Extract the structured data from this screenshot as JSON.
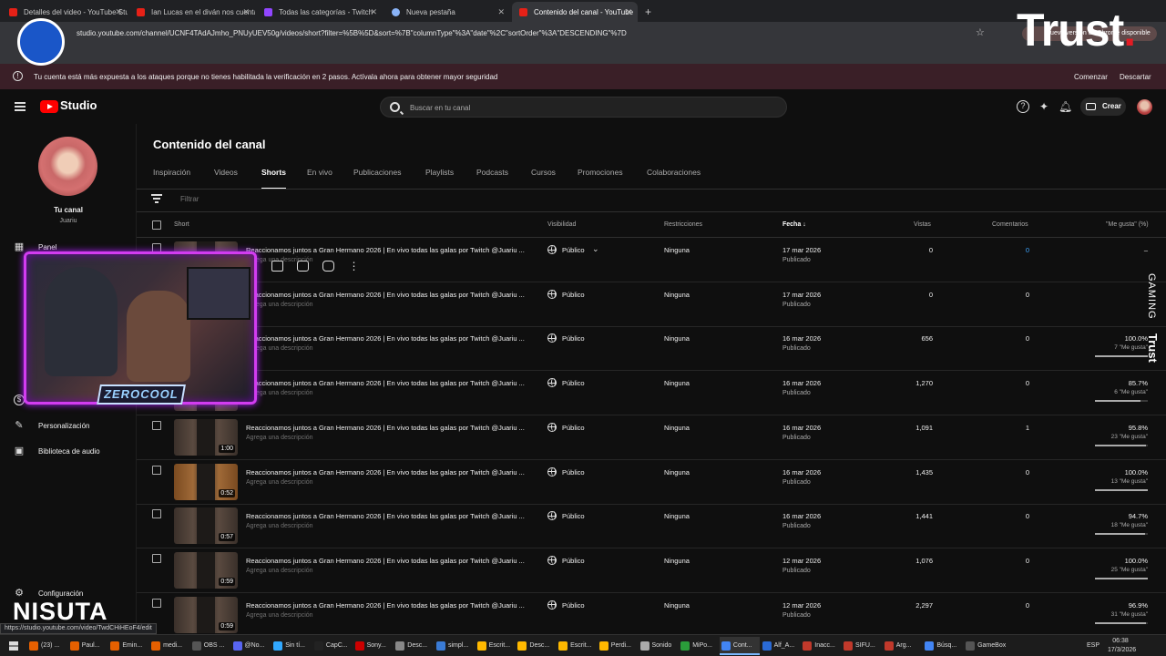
{
  "browser": {
    "tabs": [
      {
        "label": "Detalles del video - YouTube Studio",
        "icon": "youtube-icon",
        "active": false
      },
      {
        "label": "Ian Lucas en el diván nos cuenta",
        "icon": "youtube-icon",
        "active": false
      },
      {
        "label": "Todas las categorías - Twitch",
        "icon": "twitch-icon",
        "active": false
      },
      {
        "label": "Nueva pestaña",
        "icon": "chrome-icon",
        "active": false
      },
      {
        "label": "Contenido del canal - YouTube",
        "icon": "youtube-icon",
        "active": true
      }
    ],
    "new_tab": "+",
    "url": "studio.youtube.com/channel/UCNF4TAdAJmho_PNUyUEV50g/videos/short?filter=%5B%5D&sort=%7B\"columnType\"%3A\"date\"%2C\"sortOrder\"%3A\"DESCENDING\"%7D",
    "update_pill": "Nueva versión de Chrome disponible",
    "status_url": "https://studio.youtube.com/video/TwdCHiHEoF4/edit"
  },
  "security_bar": {
    "message": "Tu cuenta está más expuesta a los ataques porque no tienes habilitada la verificación en 2 pasos. Actívala ahora para obtener mayor seguridad",
    "primary": "Comenzar",
    "secondary": "Descartar"
  },
  "header": {
    "logo": "Studio",
    "search_placeholder": "Buscar en tu canal",
    "create_label": "Crear"
  },
  "sidebar": {
    "channel_name": "Tu canal",
    "channel_handle": "Juariu",
    "items": [
      {
        "label": "Panel",
        "icon": "dashboard-icon"
      },
      {
        "label": "Personalización",
        "icon": "customization-icon"
      },
      {
        "label": "Biblioteca de audio",
        "icon": "audio-library-icon"
      },
      {
        "label": "Configuración",
        "icon": "gear-icon"
      }
    ]
  },
  "main": {
    "title": "Contenido del canal",
    "tabs": [
      "Inspiración",
      "Videos",
      "Shorts",
      "En vivo",
      "Publicaciones",
      "Playlists",
      "Podcasts",
      "Cursos",
      "Promociones",
      "Colaboraciones"
    ],
    "active_tab": "Shorts",
    "filter_placeholder": "Filtrar",
    "columns": {
      "short": "Short",
      "visibility": "Visibilidad",
      "restrictions": "Restricciones",
      "date": "Fecha",
      "views": "Vistas",
      "comments": "Comentarios",
      "likes": "\"Me gusta\" (%)"
    },
    "rows": [
      {
        "title": "Reaccionamos juntos a Gran Hermano 2026 | En vivo todas las galas por Twitch @Juariu ...",
        "desc": "Agrega una descripción",
        "duration": "",
        "visibility": "Público",
        "restrictions": "Ninguna",
        "date": "17 mar 2026",
        "status": "Publicado",
        "views": "0",
        "comments": "0",
        "likes_pct": "–",
        "likes_count": "",
        "likes_fraction": 0
      },
      {
        "title": "Reaccionamos juntos a Gran Hermano 2026 | En vivo todas las galas por Twitch @Juariu ...",
        "desc": "Agrega una descripción",
        "duration": "",
        "visibility": "Público",
        "restrictions": "Ninguna",
        "date": "17 mar 2026",
        "status": "Publicado",
        "views": "0",
        "comments": "0",
        "likes_pct": "",
        "likes_count": "",
        "likes_fraction": 0
      },
      {
        "title": "Reaccionamos juntos a Gran Hermano 2026 | En vivo todas las galas por Twitch @Juariu ...",
        "desc": "Agrega una descripción",
        "duration": "",
        "visibility": "Público",
        "restrictions": "Ninguna",
        "date": "16 mar 2026",
        "status": "Publicado",
        "views": "656",
        "comments": "0",
        "likes_pct": "100.0%",
        "likes_count": "7 \"Me gusta\"",
        "likes_fraction": 1.0
      },
      {
        "title": "Reaccionamos juntos a Gran Hermano 2026 | En vivo todas las galas por Twitch @Juariu ...",
        "desc": "Agrega una descripción",
        "duration": "",
        "visibility": "Público",
        "restrictions": "Ninguna",
        "date": "16 mar 2026",
        "status": "Publicado",
        "views": "1,270",
        "comments": "0",
        "likes_pct": "85.7%",
        "likes_count": "6 \"Me gusta\"",
        "likes_fraction": 0.857
      },
      {
        "title": "Reaccionamos juntos a Gran Hermano 2026 | En vivo todas las galas por Twitch @Juariu ...",
        "desc": "Agrega una descripción",
        "duration": "1:00",
        "visibility": "Público",
        "restrictions": "Ninguna",
        "date": "16 mar 2026",
        "status": "Publicado",
        "views": "1,091",
        "comments": "1",
        "likes_pct": "95.8%",
        "likes_count": "23 \"Me gusta\"",
        "likes_fraction": 0.958
      },
      {
        "title": "Reaccionamos juntos a Gran Hermano 2026 | En vivo todas las galas por Twitch @Juariu ...",
        "desc": "Agrega una descripción",
        "duration": "0:52",
        "visibility": "Público",
        "restrictions": "Ninguna",
        "date": "16 mar 2026",
        "status": "Publicado",
        "views": "1,435",
        "comments": "0",
        "likes_pct": "100.0%",
        "likes_count": "13 \"Me gusta\"",
        "likes_fraction": 1.0
      },
      {
        "title": "Reaccionamos juntos a Gran Hermano 2026 | En vivo todas las galas por Twitch @Juariu ...",
        "desc": "Agrega una descripción",
        "duration": "0:57",
        "visibility": "Público",
        "restrictions": "Ninguna",
        "date": "16 mar 2026",
        "status": "Publicado",
        "views": "1,441",
        "comments": "0",
        "likes_pct": "94.7%",
        "likes_count": "18 \"Me gusta\"",
        "likes_fraction": 0.947
      },
      {
        "title": "Reaccionamos juntos a Gran Hermano 2026 | En vivo todas las galas por Twitch @Juariu ...",
        "desc": "Agrega una descripción",
        "duration": "0:59",
        "visibility": "Público",
        "restrictions": "Ninguna",
        "date": "12 mar 2026",
        "status": "Publicado",
        "views": "1,076",
        "comments": "0",
        "likes_pct": "100.0%",
        "likes_count": "25 \"Me gusta\"",
        "likes_fraction": 1.0
      },
      {
        "title": "Reaccionamos juntos a Gran Hermano 2026 | En vivo todas las galas por Twitch @Juariu ...",
        "desc": "Agrega una descripción",
        "duration": "0:59",
        "visibility": "Público",
        "restrictions": "Ninguna",
        "date": "12 mar 2026",
        "status": "Publicado",
        "views": "2,297",
        "comments": "0",
        "likes_pct": "96.9%",
        "likes_count": "31 \"Me gusta\"",
        "likes_fraction": 0.969
      }
    ]
  },
  "overlays": {
    "trust_logo": "Trust",
    "gaming": "GAMING",
    "trust_vertical": "Trust",
    "webcam_tag": "ZEROCOOL",
    "nisuta": "NISUTA"
  },
  "taskbar": {
    "items": [
      "(23) ...",
      "Paul...",
      "Emin...",
      "medi...",
      "OBS ...",
      "@No...",
      "Sin tí...",
      "CapC...",
      "Sony...",
      "Desc...",
      "simpl...",
      "Escrit...",
      "Desc...",
      "Escrit...",
      "Perdi...",
      "Sonido",
      "MiPo...",
      "Cont...",
      "Alf_A...",
      "Inacc...",
      "SIFU...",
      "Arg...",
      "Búsq...",
      "GameBox"
    ],
    "active_item": "Cont...",
    "lang": "ESP",
    "time": "06:38",
    "date": "17/3/2026"
  }
}
